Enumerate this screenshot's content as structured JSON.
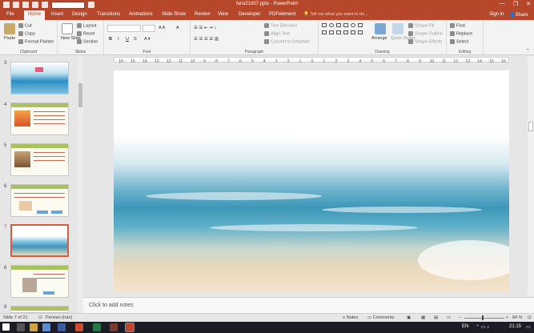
{
  "window": {
    "title": "farsi21d07.pptx - PowerPoint",
    "controls": [
      "—",
      "❐",
      "✕"
    ]
  },
  "tabs": [
    {
      "label": "File"
    },
    {
      "label": "Home"
    },
    {
      "label": "Insert"
    },
    {
      "label": "Design"
    },
    {
      "label": "Transitions"
    },
    {
      "label": "Animations"
    },
    {
      "label": "Slide Show"
    },
    {
      "label": "Review"
    },
    {
      "label": "View"
    },
    {
      "label": "Developer"
    },
    {
      "label": "PDFelement"
    }
  ],
  "active_tab": "Home",
  "tellme_placeholder": "Tell me what you want to do...",
  "account": {
    "signin": "Sign in",
    "share": "Share"
  },
  "ribbon": {
    "clipboard": {
      "label": "Clipboard",
      "paste": "Paste",
      "cut": "Cut",
      "copy": "Copy",
      "format_painter": "Format Painter"
    },
    "slides": {
      "label": "Slides",
      "new_slide": "New Slide",
      "layout": "Layout",
      "reset": "Reset",
      "section": "Section"
    },
    "font": {
      "label": "Font",
      "bold": "B",
      "italic": "I",
      "underline": "U",
      "shadow": "S"
    },
    "paragraph": {
      "label": "Paragraph",
      "text_direction": "Text Direction",
      "align_text": "Align Text",
      "convert_smartart": "Convert to SmartArt"
    },
    "drawing": {
      "label": "Drawing",
      "arrange": "Arrange",
      "quick_styles": "Quick Styles",
      "shape_fill": "Shape Fill",
      "shape_outline": "Shape Outline",
      "shape_effects": "Shape Effects"
    },
    "editing": {
      "label": "Editing",
      "find": "Find",
      "replace": "Replace",
      "select": "Select"
    }
  },
  "ruler_ticks": [
    "16",
    "15",
    "14",
    "13",
    "12",
    "11",
    "10",
    "9",
    "8",
    "7",
    "6",
    "5",
    "4",
    "3",
    "2",
    "1",
    "0",
    "1",
    "2",
    "3",
    "4",
    "5",
    "6",
    "7",
    "8",
    "9",
    "10",
    "11",
    "12",
    "13",
    "14",
    "15",
    "16"
  ],
  "thumbnails": [
    {
      "number": "3",
      "kind": "sea"
    },
    {
      "number": "4",
      "kind": "text-fire"
    },
    {
      "number": "5",
      "kind": "text-photo"
    },
    {
      "number": "6",
      "kind": "text-pen"
    },
    {
      "number": "7",
      "kind": "sea",
      "selected": true
    },
    {
      "number": "8",
      "kind": "text-portrait"
    },
    {
      "number": "9",
      "kind": "text"
    }
  ],
  "notes_placeholder": "Click to add notes",
  "status": {
    "slide_info": "Slide 7 of 21",
    "language": "Persian (Iran)",
    "notes": "Notes",
    "comments": "Comments",
    "zoom": "84 %"
  },
  "taskbar": {
    "lang": "EN",
    "time": "21:15"
  }
}
